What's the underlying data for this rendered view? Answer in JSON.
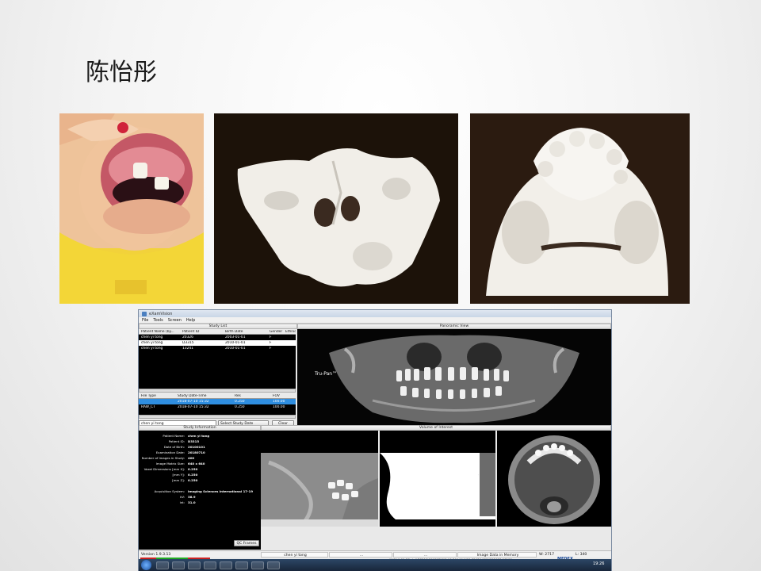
{
  "slide": {
    "title": "陈怡彤"
  },
  "app": {
    "window_title": "eXamVision",
    "menu": [
      "File",
      "Tools",
      "Screen",
      "Help"
    ],
    "study_list": {
      "header": "Study List",
      "columns": [
        "Patient Name (by...",
        "Patient ID",
        "Birth Date",
        "Gender",
        "Ethnic"
      ],
      "rows": [
        [
          "chen yi tong",
          "20326",
          "2003-01-01",
          "F",
          ""
        ],
        [
          "chen yi tong",
          "D3315",
          "2010-01-01",
          "F",
          ""
        ],
        [
          "chen yi tong",
          "13241",
          "2010-01-01",
          "F",
          ""
        ]
      ]
    },
    "file_list": {
      "columns": [
        "File Type",
        "Study Date-Time",
        "Res",
        "FOV"
      ],
      "rows": [
        [
          "",
          "2018-07-10 15:32",
          "0.250",
          "100.00"
        ],
        [
          "RAW_CT",
          "2018-07-10 15:32",
          "0.250",
          "100.00"
        ]
      ]
    },
    "search": {
      "value": "chen yi tong",
      "select_label": "Select Study Date",
      "clear_label": "Clear"
    },
    "panoramic": {
      "header": "Panoramic View",
      "label": "Tru-Pan™"
    },
    "study_info": {
      "header": "Study Information",
      "fields": [
        {
          "label": "Patient Name:",
          "value": "chen yi tong"
        },
        {
          "label": "Patient ID:",
          "value": "D3315"
        },
        {
          "label": "Date of Birth:",
          "value": "20100101"
        },
        {
          "label": "Examination Date:",
          "value": "20180710"
        },
        {
          "label": "Number of Images in Study:",
          "value": "400"
        },
        {
          "label": "Image Matrix Size:",
          "value": "640 x 640"
        },
        {
          "label": "Voxel Dimensions [mm X]:",
          "value": "0.250"
        },
        {
          "label": "[mm Y]:",
          "value": "0.250"
        },
        {
          "label": "[mm Z]:",
          "value": "0.250"
        },
        {
          "label": "Acquisition System:",
          "value": "Imaging Sciences International 17-19"
        },
        {
          "label": "kV:",
          "value": "38.9"
        },
        {
          "label": "lnt:",
          "value": "31.0"
        }
      ],
      "qc_button": "QC Frames"
    },
    "voi": {
      "header": "Volume of Interest"
    },
    "status": {
      "version": "Version 1.9.3.13",
      "patient": "chen yi tong",
      "dots1": "...",
      "dots2": "...",
      "memory": "Image Data in Memory",
      "w_label": "W:",
      "w_value": "2717",
      "l_label": "L:",
      "l_value": "340",
      "path": "\\\\169.1.99.30\\pkrt\\D3315\\20180710\\2.16.840.114421.82434.9584552023.96166",
      "brand": "MEDEX",
      "time": "19:26"
    }
  }
}
